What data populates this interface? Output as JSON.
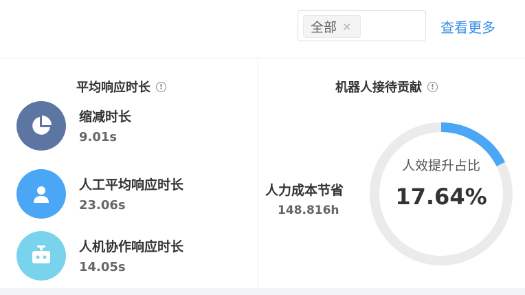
{
  "filter": {
    "tag_label": "全部",
    "close_symbol": "×",
    "more_link": "查看更多"
  },
  "avg_response": {
    "title": "平均响应时长",
    "info_symbol": "!",
    "items": [
      {
        "label": "缩减时长",
        "value": "9.01s",
        "icon": "pie-chart-icon",
        "color": "#5d75a2"
      },
      {
        "label": "人工平均响应时长",
        "value": "23.06s",
        "icon": "user-icon",
        "color": "#4aa7f5"
      },
      {
        "label": "人机协作响应时长",
        "value": "14.05s",
        "icon": "robot-icon",
        "color": "#7ad3ec"
      }
    ]
  },
  "robot_contribution": {
    "title": "机器人接待贡献",
    "info_symbol": "!",
    "saving_label": "人力成本节省",
    "saving_value": "148.816h",
    "ring_label": "人效提升占比",
    "ring_value": "17.64%",
    "ring_percent": 17.64,
    "ring_color": "#4aa7f5",
    "ring_track_color": "#ebebeb"
  }
}
